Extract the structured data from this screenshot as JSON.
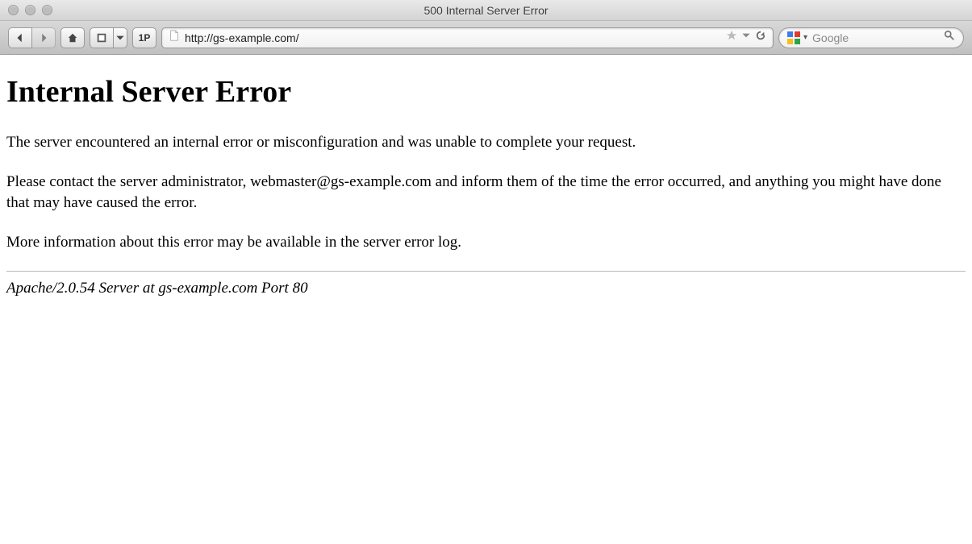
{
  "window": {
    "title": "500 Internal Server Error"
  },
  "toolbar": {
    "onep_label": "1P",
    "url": "http://gs-example.com/",
    "search_placeholder": "Google"
  },
  "page": {
    "heading": "Internal Server Error",
    "para1": "The server encountered an internal error or misconfiguration and was unable to complete your request.",
    "para2": "Please contact the server administrator, webmaster@gs-example.com and inform them of the time the error occurred, and anything you might have done that may have caused the error.",
    "para3": "More information about this error may be available in the server error log.",
    "signature": "Apache/2.0.54 Server at gs-example.com Port 80"
  }
}
